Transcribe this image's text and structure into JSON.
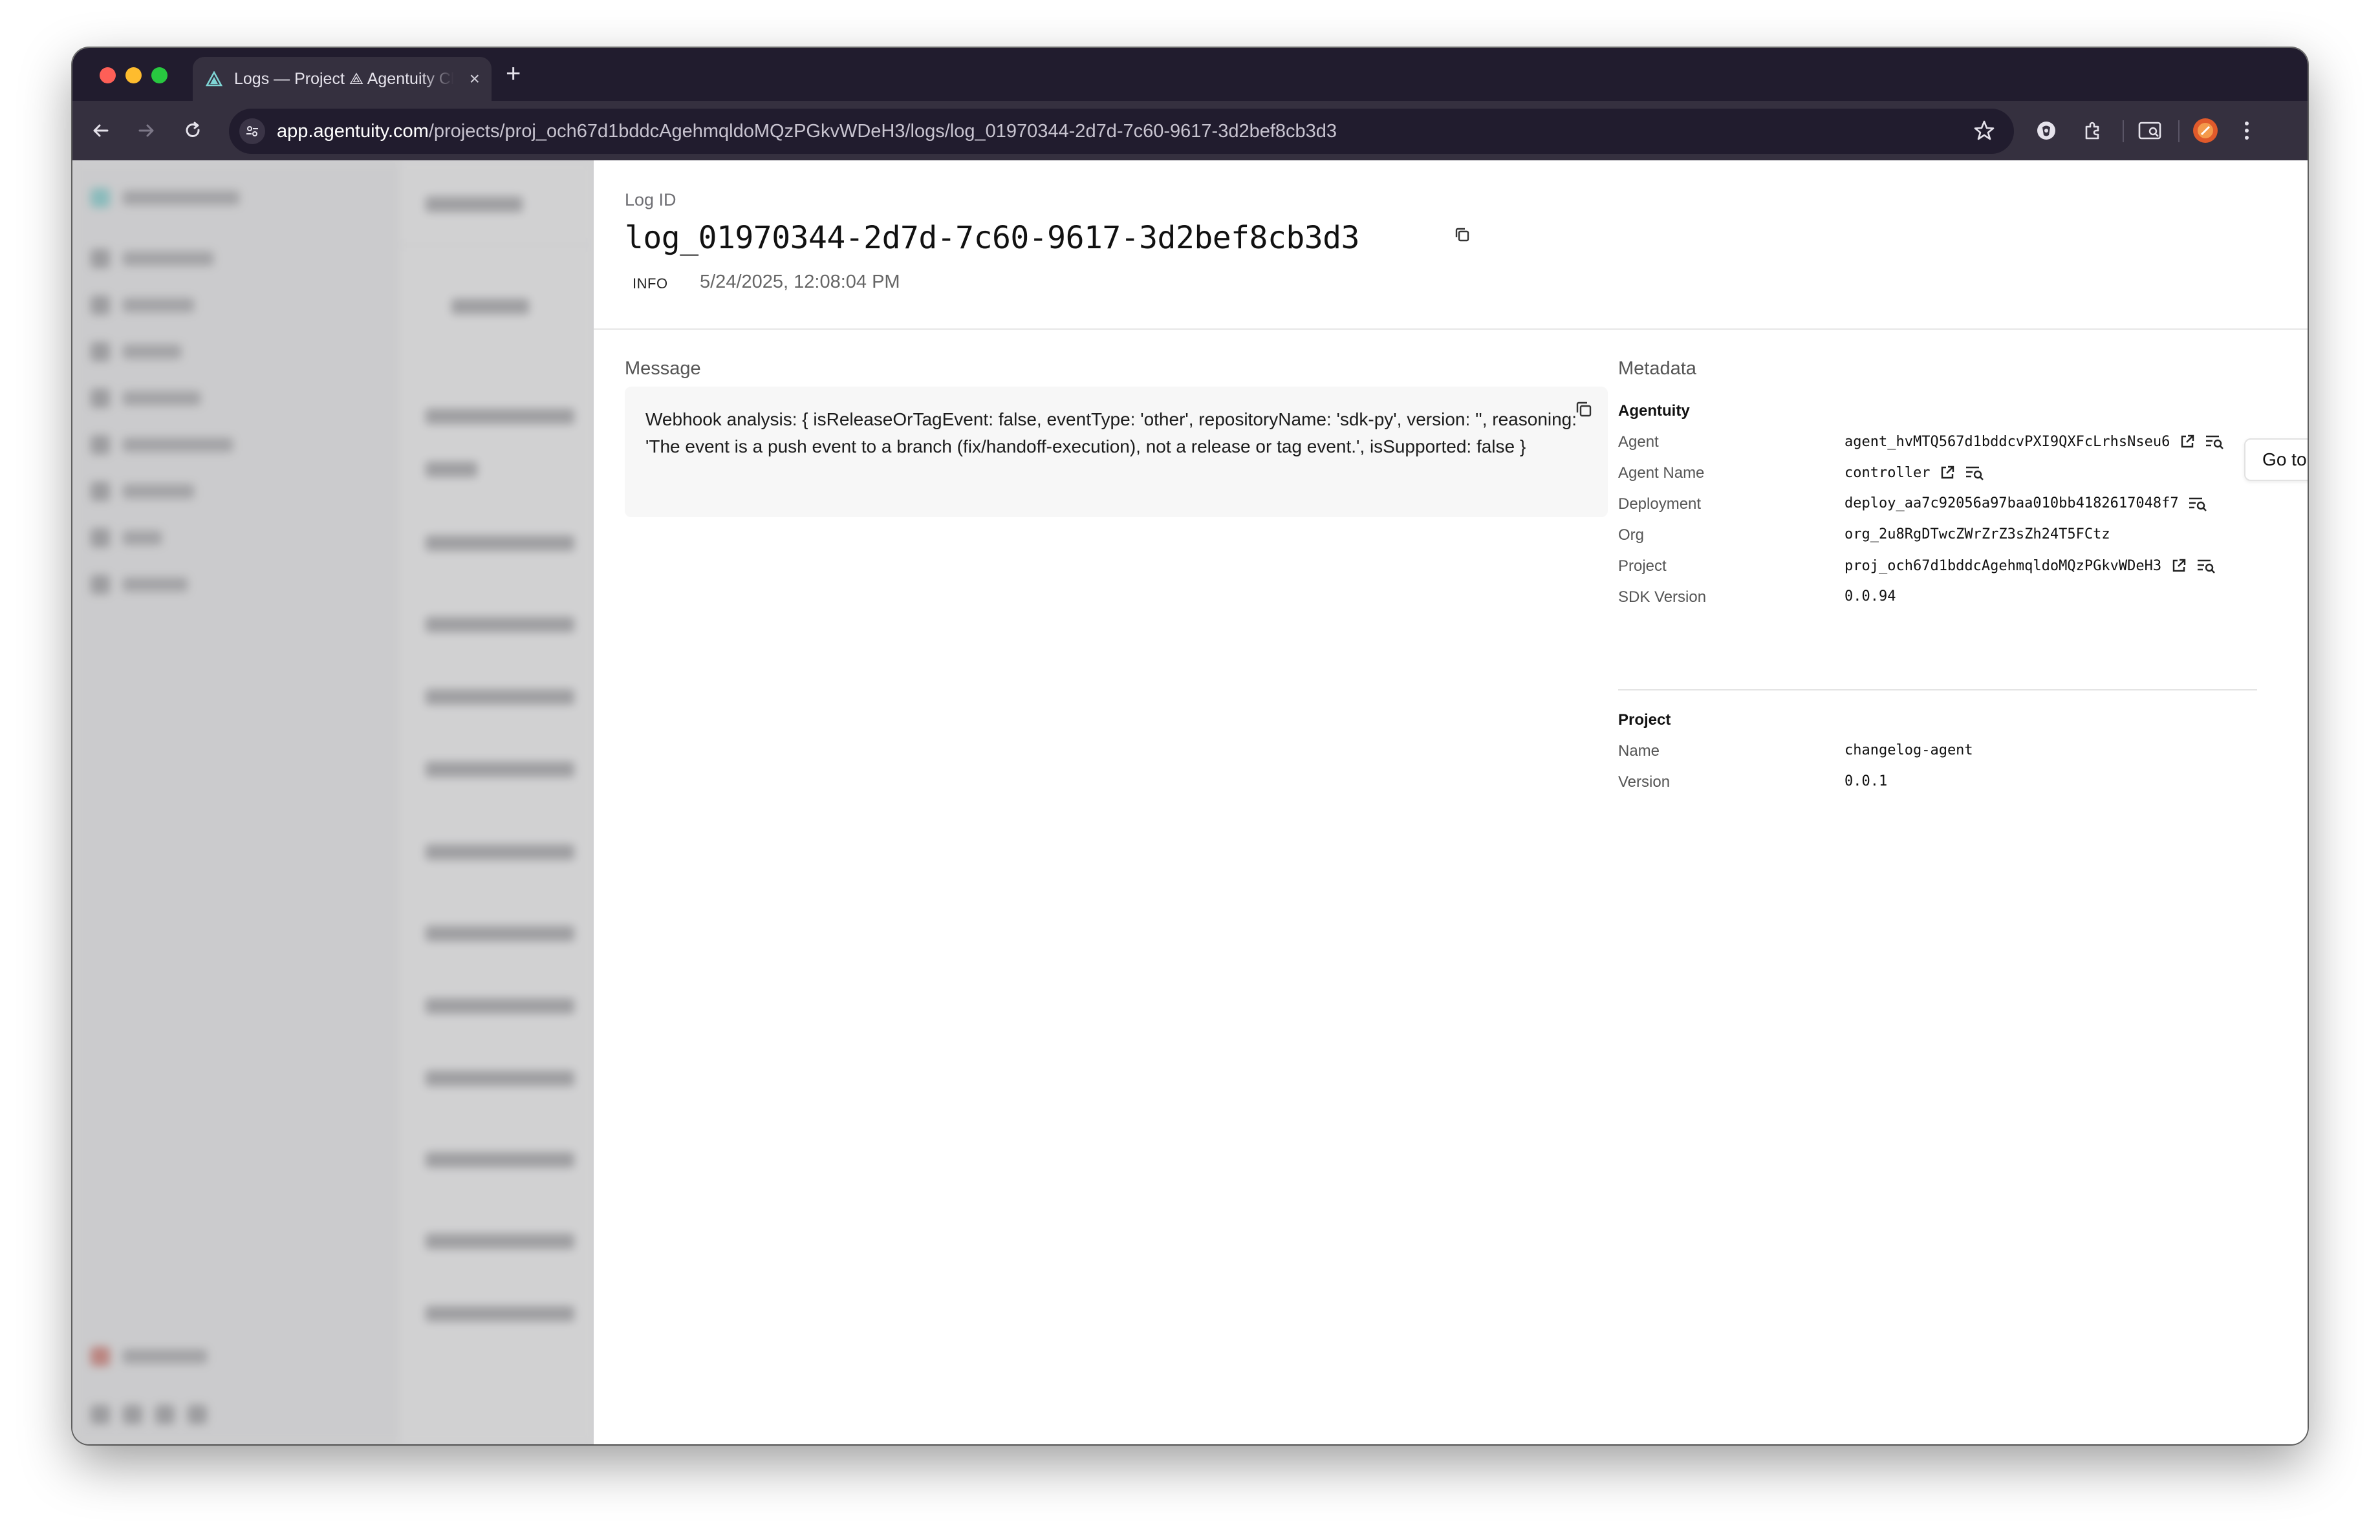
{
  "browser": {
    "tab_title": "Logs — Project ⟁ Agentuity Cloud",
    "tab_close": "×",
    "new_tab": "+",
    "url_host": "app.agentuity.com",
    "url_path": "/projects/proj_och67d1bddcAgehmqldoMQzPGkvWDeH3/logs/log_01970344-2d7d-7c60-9617-3d2bef8cb3d3"
  },
  "log": {
    "id_label": "Log ID",
    "id": "log_01970344-2d7d-7c60-9617-3d2bef8cb3d3",
    "level": "INFO",
    "timestamp": "5/24/2025, 12:08:04 PM"
  },
  "message": {
    "title": "Message",
    "text": "Webhook analysis: { isReleaseOrTagEvent: false, eventType: 'other', repositoryName: 'sdk-py', version: '', reasoning: 'The event is a push event to a branch (fix/handoff-execution), not a release or tag event.', isSupported: false }"
  },
  "metadata": {
    "title": "Metadata",
    "tooltip": "Go to Agent",
    "agentuity": {
      "heading": "Agentuity",
      "agent_key": "Agent",
      "agent_value": "agent_hvMTQ567d1bddcvPXI9QXFcLrhsNseu6",
      "agent_name_key": "Agent Name",
      "agent_name_value": "controller",
      "deployment_key": "Deployment",
      "deployment_value": "deploy_aa7c92056a97baa010bb4182617048f7",
      "org_key": "Org",
      "org_value": "org_2u8RgDTwcZWrZrZ3sZh24T5FCtz",
      "project_key": "Project",
      "project_value": "proj_och67d1bddcAgehmqldoMQzPGkvWDeH3",
      "sdk_key": "SDK Version",
      "sdk_value": "0.0.94"
    },
    "project": {
      "heading": "Project",
      "name_key": "Name",
      "name_value": "changelog-agent",
      "version_key": "Version",
      "version_value": "0.0.1"
    }
  },
  "colors": {
    "tab_strip": "#211c2e",
    "toolbar": "#35303f",
    "brand": "#3ec4c4"
  },
  "icons": [
    "agentuity-logo-icon",
    "close-icon",
    "plus-icon",
    "back-arrow-icon",
    "forward-arrow-icon",
    "reload-icon",
    "site-info-icon",
    "star-icon",
    "shield-icon",
    "extensions-icon",
    "sidepanel-icon",
    "profile-avatar-icon",
    "kebab-menu-icon",
    "copy-icon",
    "external-link-icon",
    "filter-logs-icon"
  ]
}
